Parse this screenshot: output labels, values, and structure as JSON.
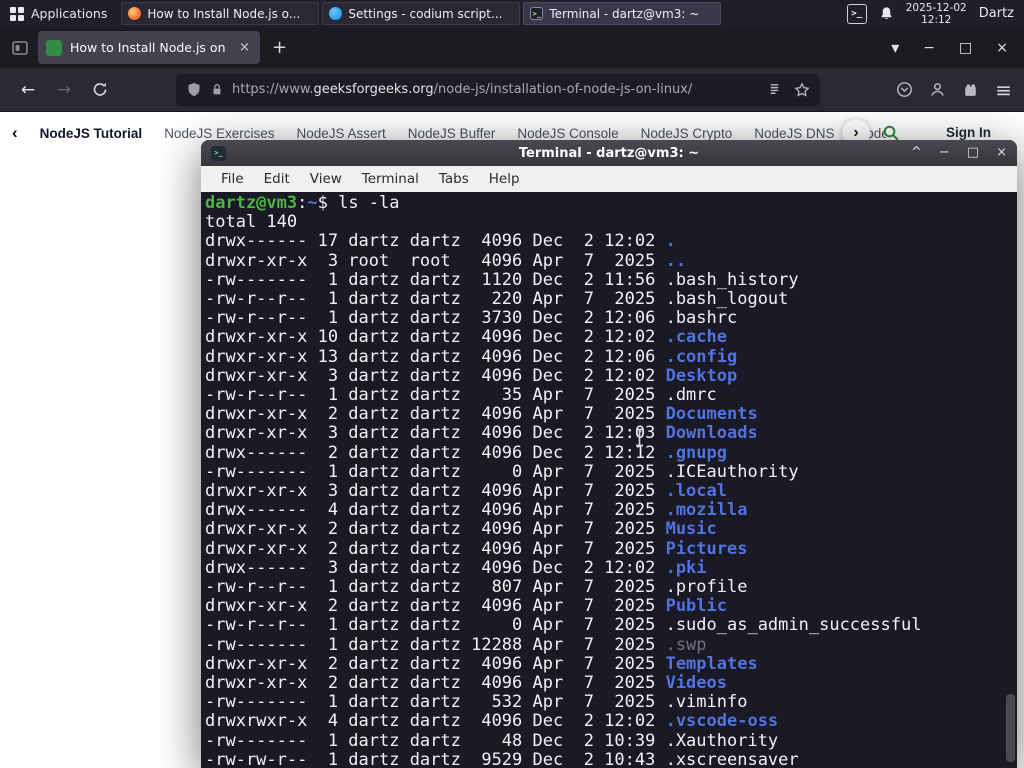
{
  "panel": {
    "applications_label": "Applications",
    "windows": [
      {
        "title": "How to Install Node.js o...",
        "icon": "firefox",
        "active": false
      },
      {
        "title": "Settings - codium script...",
        "icon": "codium",
        "active": false
      },
      {
        "title": "Terminal - dartz@vm3: ~",
        "icon": "terminal",
        "active": true
      }
    ],
    "date": "2025-12-02",
    "time": "12:12",
    "user": "Dartz"
  },
  "browser": {
    "tab": {
      "title": "How to Install Node.js on"
    },
    "url": {
      "prefix": "https://www.",
      "domain": "geeksforgeeks.org",
      "path": "/node-js/installation-of-node-js-on-linux/"
    }
  },
  "site_nav": {
    "items": [
      "NodeJS Tutorial",
      "NodeJS Exercises",
      "NodeJS Assert",
      "NodeJS Buffer",
      "NodeJS Console",
      "NodeJS Crypto",
      "NodeJS DNS",
      "Node"
    ],
    "sign_in_label": "Sign In"
  },
  "terminal": {
    "title": "Terminal - dartz@vm3: ~",
    "menu": [
      "File",
      "Edit",
      "View",
      "Terminal",
      "Tabs",
      "Help"
    ],
    "prompt": {
      "user_host": "dartz@vm3",
      "colon": ":",
      "path": "~",
      "symbol": "$",
      "command": "ls -la"
    },
    "total_line": "total 140",
    "rows": [
      {
        "meta": "drwx------ 17 dartz dartz  4096 Dec  2 12:02 ",
        "name": ".",
        "color": "dir"
      },
      {
        "meta": "drwxr-xr-x  3 root  root   4096 Apr  7  2025 ",
        "name": "..",
        "color": "dir"
      },
      {
        "meta": "-rw-------  1 dartz dartz  1120 Dec  2 11:56 ",
        "name": ".bash_history",
        "color": "file"
      },
      {
        "meta": "-rw-r--r--  1 dartz dartz   220 Apr  7  2025 ",
        "name": ".bash_logout",
        "color": "file"
      },
      {
        "meta": "-rw-r--r--  1 dartz dartz  3730 Dec  2 12:06 ",
        "name": ".bashrc",
        "color": "file"
      },
      {
        "meta": "drwxr-xr-x 10 dartz dartz  4096 Dec  2 12:02 ",
        "name": ".cache",
        "color": "dir"
      },
      {
        "meta": "drwxr-xr-x 13 dartz dartz  4096 Dec  2 12:06 ",
        "name": ".config",
        "color": "dir"
      },
      {
        "meta": "drwxr-xr-x  3 dartz dartz  4096 Dec  2 12:02 ",
        "name": "Desktop",
        "color": "dir"
      },
      {
        "meta": "-rw-r--r--  1 dartz dartz    35 Apr  7  2025 ",
        "name": ".dmrc",
        "color": "file"
      },
      {
        "meta": "drwxr-xr-x  2 dartz dartz  4096 Apr  7  2025 ",
        "name": "Documents",
        "color": "dir"
      },
      {
        "meta": "drwxr-xr-x  3 dartz dartz  4096 Dec  2 12:03 ",
        "name": "Downloads",
        "color": "dir"
      },
      {
        "meta": "drwx------  2 dartz dartz  4096 Dec  2 12:12 ",
        "name": ".gnupg",
        "color": "dir"
      },
      {
        "meta": "-rw-------  1 dartz dartz     0 Apr  7  2025 ",
        "name": ".ICEauthority",
        "color": "file"
      },
      {
        "meta": "drwxr-xr-x  3 dartz dartz  4096 Apr  7  2025 ",
        "name": ".local",
        "color": "dir"
      },
      {
        "meta": "drwx------  4 dartz dartz  4096 Apr  7  2025 ",
        "name": ".mozilla",
        "color": "dir"
      },
      {
        "meta": "drwxr-xr-x  2 dartz dartz  4096 Apr  7  2025 ",
        "name": "Music",
        "color": "dir"
      },
      {
        "meta": "drwxr-xr-x  2 dartz dartz  4096 Apr  7  2025 ",
        "name": "Pictures",
        "color": "dir"
      },
      {
        "meta": "drwx------  3 dartz dartz  4096 Dec  2 12:02 ",
        "name": ".pki",
        "color": "dir"
      },
      {
        "meta": "-rw-r--r--  1 dartz dartz   807 Apr  7  2025 ",
        "name": ".profile",
        "color": "file"
      },
      {
        "meta": "drwxr-xr-x  2 dartz dartz  4096 Apr  7  2025 ",
        "name": "Public",
        "color": "dir"
      },
      {
        "meta": "-rw-r--r--  1 dartz dartz     0 Apr  7  2025 ",
        "name": ".sudo_as_admin_successful",
        "color": "file"
      },
      {
        "meta": "-rw-------  1 dartz dartz 12288 Apr  7  2025 ",
        "name": ".swp",
        "color": "dim"
      },
      {
        "meta": "drwxr-xr-x  2 dartz dartz  4096 Apr  7  2025 ",
        "name": "Templates",
        "color": "dir"
      },
      {
        "meta": "drwxr-xr-x  2 dartz dartz  4096 Apr  7  2025 ",
        "name": "Videos",
        "color": "dir"
      },
      {
        "meta": "-rw-------  1 dartz dartz   532 Apr  7  2025 ",
        "name": ".viminfo",
        "color": "file"
      },
      {
        "meta": "drwxrwxr-x  4 dartz dartz  4096 Dec  2 12:02 ",
        "name": ".vscode-oss",
        "color": "dir"
      },
      {
        "meta": "-rw-------  1 dartz dartz    48 Dec  2 10:39 ",
        "name": ".Xauthority",
        "color": "file"
      },
      {
        "meta": "-rw-rw-r--  1 dartz dartz  9529 Dec  2 10:43 ",
        "name": ".xscreensaver",
        "color": "file"
      }
    ]
  },
  "icons": {
    "close": "×",
    "minimize": "−",
    "maximize": "□",
    "shade": "^",
    "new_tab": "+",
    "tab_list": "▾",
    "back": "←",
    "forward": "→",
    "nav_prev": "‹",
    "nav_next": "›",
    "menu": "≡",
    "terminal_glyph": ">_"
  },
  "colors": {
    "accent_green": "#2f8d46",
    "dir_blue": "#5272dd",
    "prompt_green": "#4db344",
    "dim_gray": "#70707e",
    "term_bg": "#1a1926",
    "panel_bg": "#201f29"
  }
}
